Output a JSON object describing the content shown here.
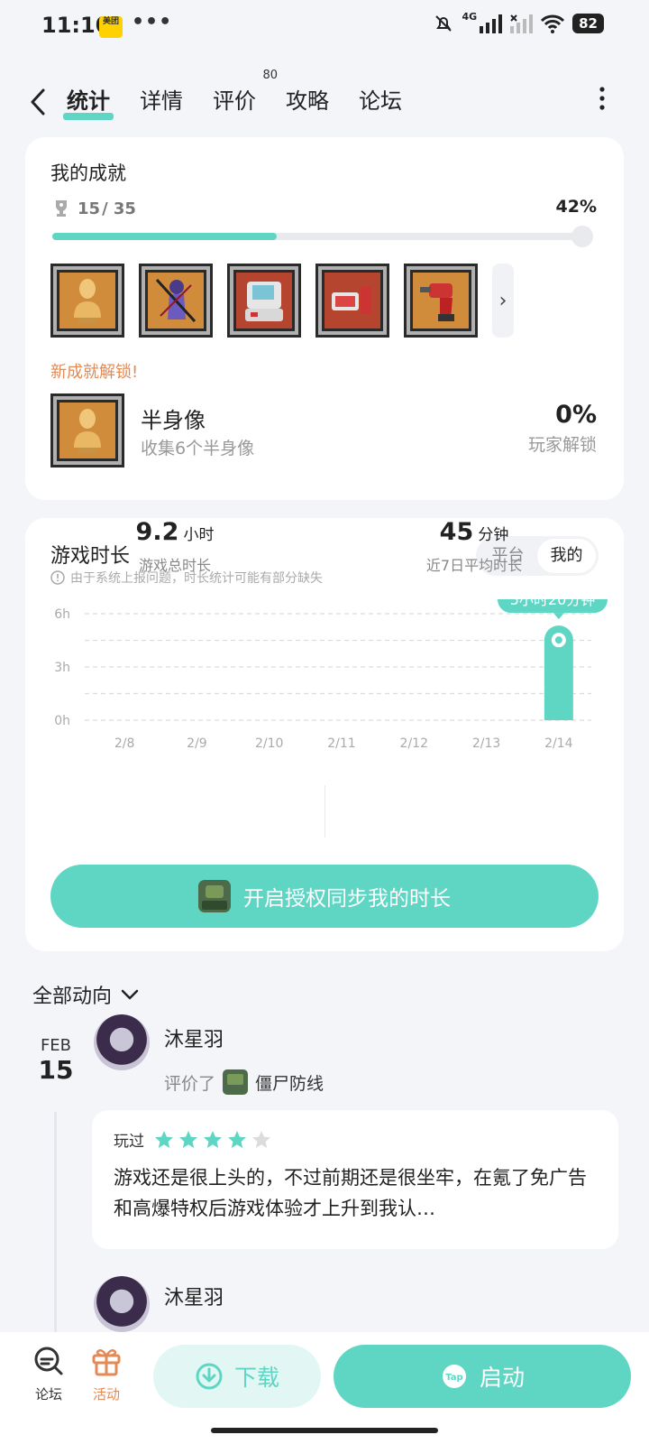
{
  "status": {
    "time": "11:10",
    "app_badge": "美团",
    "dots": "•••",
    "network": "4G",
    "battery": "82"
  },
  "nav": {
    "tabs": [
      {
        "label": "统计",
        "active": true
      },
      {
        "label": "详情",
        "active": false
      },
      {
        "label": "评价",
        "active": false,
        "badge": "80"
      },
      {
        "label": "攻略",
        "active": false
      },
      {
        "label": "论坛",
        "active": false
      }
    ]
  },
  "achievements": {
    "title": "我的成就",
    "unlocked": "15",
    "total": "/ 35",
    "percent_label": "42%",
    "percent": 0.42,
    "badges": [
      "bust-icon",
      "swordgirl-icon",
      "machine-icon",
      "device-icon",
      "drill-icon"
    ],
    "new_label": "新成就解锁!",
    "new": {
      "name": "半身像",
      "desc": "收集6个半身像",
      "percent": "0%",
      "percent_label": "玩家解锁"
    }
  },
  "playtime": {
    "title": "游戏时长",
    "notice": "由于系统上报问题，时长统计可能有部分缺失",
    "toggle": [
      "平台",
      "我的"
    ],
    "toggle_active": 1,
    "tooltip": "5小时20分钟",
    "total_value": "9.2",
    "total_unit": "小时",
    "total_label": "游戏总时长",
    "avg_value": "45",
    "avg_unit": "分钟",
    "avg_label": "近7日平均时长",
    "sync_button": "开启授权同步我的时长"
  },
  "chart_data": {
    "type": "bar",
    "categories": [
      "2/8",
      "2/9",
      "2/10",
      "2/11",
      "2/12",
      "2/13",
      "2/14"
    ],
    "values": [
      0,
      0,
      0,
      0,
      0,
      0,
      5.33
    ],
    "ylabel_ticks": [
      "6h",
      "3h",
      "0h"
    ],
    "ylim": [
      0,
      6
    ],
    "grid": true,
    "bar_color": "#5fd6c4"
  },
  "feed": {
    "header": "全部动向",
    "date_month": "FEB",
    "date_day": "15",
    "username": "沐星羽",
    "action": "评价了",
    "game": "僵尸防线",
    "review_tag": "玩过",
    "stars": 4,
    "max_stars": 5,
    "review_text": "游戏还是很上头的，不过前期还是很坐牢，在氪了免广告和高爆特权后游戏体验才上升到我认…",
    "username2": "沐星羽"
  },
  "bottom": {
    "forum": "论坛",
    "activity": "活动",
    "download": "下载",
    "launch": "启动",
    "launch_badge": "Tap"
  },
  "colors": {
    "accent": "#5fd6c4",
    "orange": "#e38a55"
  }
}
